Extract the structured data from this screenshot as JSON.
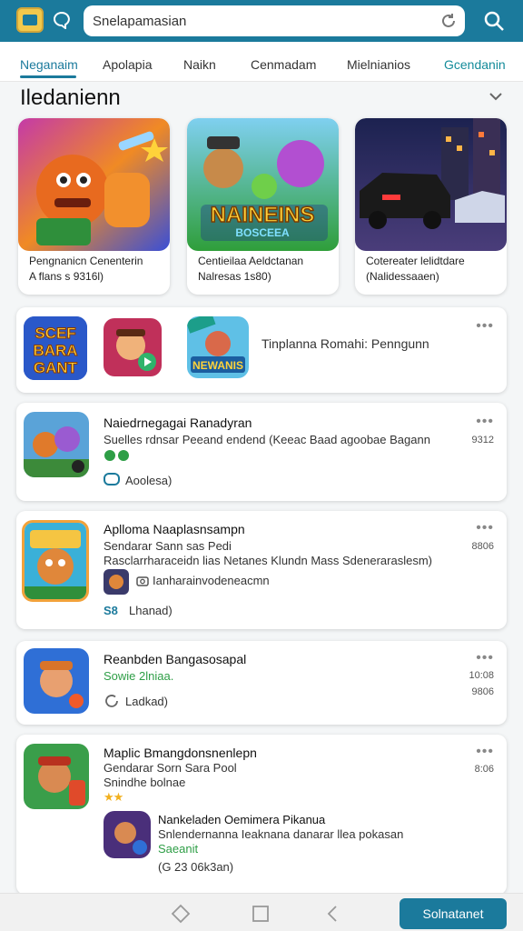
{
  "header": {
    "search_text": "Snelapamasian"
  },
  "tabs": [
    {
      "label": "Neganaim"
    },
    {
      "label": "Apolapia"
    },
    {
      "label": "Naikn"
    },
    {
      "label": "Cenmadam"
    },
    {
      "label": "Mielnianios"
    },
    {
      "label": "Gcendanin"
    }
  ],
  "section": {
    "title": "Iledanienn"
  },
  "featured": [
    {
      "line1": "Pengnanicn Cenenterin",
      "line2": "A flans s 9316l)",
      "art_text": ""
    },
    {
      "line1": "Centieilaa Aeldctanan",
      "line2": "Nalresas 1s80)",
      "art_text_1": "NAINEINS",
      "art_text_2": "BOSCEEA"
    },
    {
      "line1": "Cotereater lelidtdare",
      "line2": "(Nalidessaaen)"
    }
  ],
  "promo_card": {
    "text": "Tinplanna Romahi: Penngunn",
    "art1_text": [
      "SCEF",
      "BARA",
      "GANT"
    ],
    "art3_text": "NEWANIS"
  },
  "apps": [
    {
      "title": "Naiedrnegagai Ranadyran",
      "desc": "Suelles rdnsar Peeand endend (Keeac Baad agoobae Bagann",
      "meta": "Aoolesa)",
      "side": "9312"
    },
    {
      "title": "Aplloma Naaplasnsampn",
      "desc": "Sendarar Sann sas Pedi",
      "desc2": "Rasclarrharaceidn lias Netanes Klundn Mass Sdeneraraslesm)",
      "sub_meta": "Ianharainvodeneacmn",
      "badge": "S8",
      "meta": "Lhanad)",
      "side": "8806"
    },
    {
      "title": "Reanbden Bangasosapal",
      "green": "Sowie 2lniaa.",
      "meta": "Ladkad)",
      "side": "10:08",
      "side2": "9806"
    },
    {
      "title": "Maplic Bmangdonsnenlepn",
      "desc": "Gendarar Sorn Sara Pool",
      "desc2": "Snindhe bolnae",
      "side": "8:06",
      "nested": {
        "title": "Nankeladen Oemimera Pikanua",
        "desc": "Snlendernanna Ieaknana danarar llea pokasan",
        "green": "Saeanit",
        "meta": "(G 23 06k3an)"
      }
    }
  ],
  "bottom": {
    "cta_label": "Solnatanet"
  },
  "colors": {
    "brand": "#1b7a9c",
    "green": "#2e9e46"
  }
}
